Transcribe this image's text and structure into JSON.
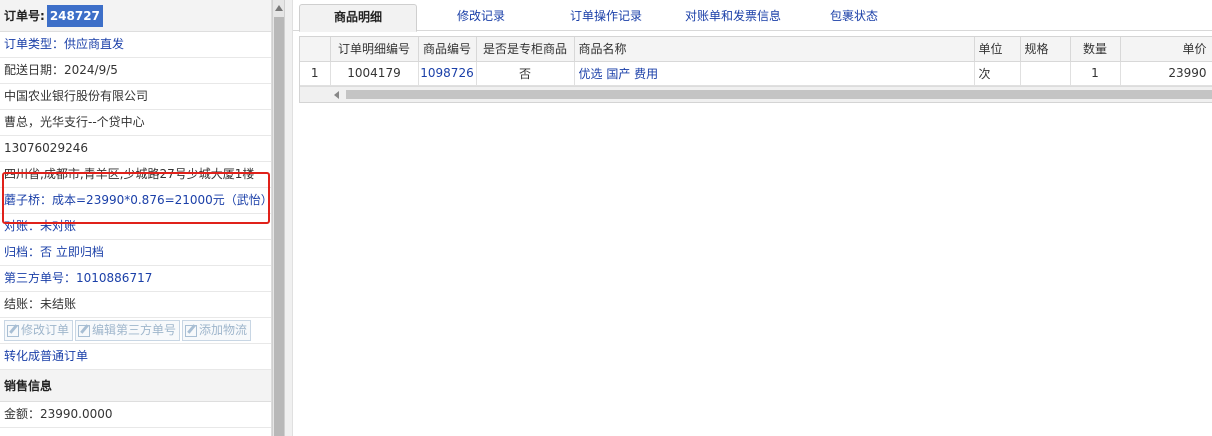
{
  "left": {
    "order_no_label": "订单号:",
    "order_no": "248727",
    "order_type": "订单类型：供应商直发",
    "ship_date": "配送日期：2024/9/5",
    "company": "中国农业银行股份有限公司",
    "contact": "曹总，光华支行--个贷中心",
    "phone": "13076029246",
    "address": "四川省,成都市,青羊区,少城路27号少城大厦1楼",
    "cost_note": "蘑子桥：成本=23990*0.876=21000元（武怡）",
    "reconcile": "对账：未对账",
    "archive": "归档：否 立即归档",
    "third_party_no": "第三方单号：1010886717",
    "settlement": "结账：未结账",
    "buttons": {
      "edit_order": "修改订单",
      "edit_third_party": "编辑第三方单号",
      "add_logistics": "添加物流"
    },
    "convert": "转化成普通订单",
    "sales_info_title": "销售信息",
    "amount": "金额：23990.0000"
  },
  "tabs": [
    "商品明细",
    "修改记录",
    "订单操作记录",
    "对账单和发票信息",
    "包裹状态"
  ],
  "grid": {
    "headers": [
      "",
      "订单明细编号",
      "商品编号",
      "是否是专柜商品",
      "商品名称",
      "单位",
      "规格",
      "数量",
      "单价"
    ],
    "rows": [
      [
        "1",
        "1004179",
        "1098726",
        "否",
        "优选 国产 费用",
        "次",
        "",
        "1",
        "23990"
      ]
    ]
  },
  "colors": {
    "accent_blue": "#1a3fa8",
    "highlight_red": "#e0211a",
    "order_no_bg": "#3d6fc8"
  }
}
